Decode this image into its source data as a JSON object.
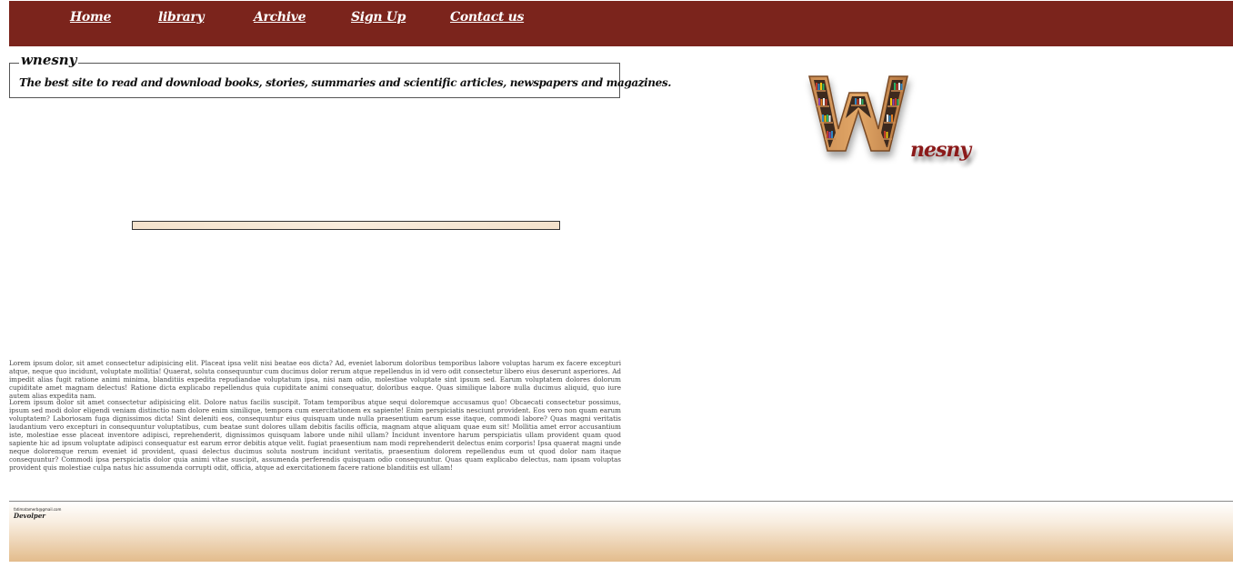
{
  "nav": {
    "items": [
      {
        "label": "Home"
      },
      {
        "label": "library"
      },
      {
        "label": "Archive"
      },
      {
        "label": "Sign Up"
      },
      {
        "label": "Contact us"
      }
    ]
  },
  "intro": {
    "legend": "wnesny",
    "text": "The best site to read and download books, stories, summaries and scientific articles, newspapers and magazines."
  },
  "logo": {
    "letter": "W",
    "text": "nesny"
  },
  "progress": {
    "value": 1.0
  },
  "content": {
    "paragraphs": [
      "Lorem ipsum dolor, sit amet consectetur adipisicing elit. Placeat ipsa velit nisi beatae eos dicta? Ad, eveniet laborum doloribus temporibus labore voluptas harum ex facere excepturi atque, neque quo incidunt, voluptate mollitia! Quaerat, soluta consequuntur cum ducimus dolor rerum atque repellendus in id vero odit consectetur libero eius deserunt asperiores. Ad impedit alias fugit ratione animi minima, blanditiis expedita repudiandae voluptatum ipsa, nisi nam odio, molestiae voluptate sint ipsum sed. Earum voluptatem dolores dolorum cupiditate amet magnam delectus! Ratione dicta explicabo repellendus quia cupiditate animi consequatur, doloribus eaque. Quas similique labore nulla ducimus aliquid, quo iure autem alias expedita nam.",
      "Lorem ipsum dolor sit amet consectetur adipisicing elit. Dolore natus facilis suscipit. Totam temporibus atque sequi doloremque accusamus quo! Obcaecati consectetur possimus, ipsum sed modi dolor eligendi veniam distinctio nam dolore enim similique, tempora cum exercitationem ex sapiente! Enim perspiciatis nesciunt provident. Eos vero non quam earum voluptatem? Laboriosam fuga dignissimos dicta! Sint deleniti eos, consequuntur eius quisquam unde nulla praesentium earum esse itaque, commodi labore? Quas magni veritatis laudantium vero excepturi in consequuntur voluptatibus, cum beatae sunt dolores ullam debitis facilis officia, magnam atque aliquam quae eum sit! Mollitia amet error accusantium iste, molestiae esse placeat inventore adipisci, reprehenderit, dignissimos quisquam labore unde nihil ullam? Incidunt inventore harum perspiciatis ullam provident quam quod sapiente hic ad ipsum voluptate adipisci consequatur est earum error debitis atque velit. fugiat praesentium nam modi reprehenderit delectus enim corporis! Ipsa quaerat magni unde neque doloremque rerum eveniet id provident, quasi delectus ducimus soluta nostrum incidunt veritatis, praesentium dolorem repellendus eum ut quod dolor nam itaque consequuntur? Commodi ipsa perspiciatis dolor quia animi vitae suscipit, assumenda perferendis quisquam odio consequuntur. Quas quam explicabo delectus, nam ipsam voluptas provident quis molestiae culpa natus hic assumenda corrupti odit, officia, atque ad exercitationem facere ratione blanditiis est ullam!"
    ]
  },
  "footer": {
    "email": "fatimatamerb@gmail.com",
    "role": "Devolper"
  },
  "colors": {
    "nav_bg": "#7b241c",
    "logo_text": "#8b1a1a",
    "footer_gradient_end": "#e3bc8c"
  }
}
